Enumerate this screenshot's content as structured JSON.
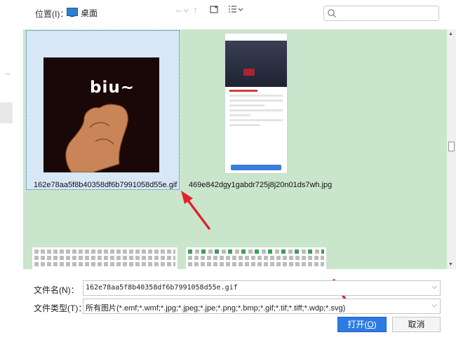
{
  "toolbar": {
    "location_label": "位置(I)：",
    "location_value": "桌面",
    "location_icon": "desktop-icon",
    "back_icon": "←",
    "up_icon": "↑",
    "new_folder_icon": "new-folder-icon",
    "view_icon": "view-list-icon",
    "search_placeholder": ""
  },
  "files": [
    {
      "name": "162e78aa5f8b40358df6b7991058d55e.gif",
      "selected": true,
      "thumb_text": "biu~"
    },
    {
      "name": "469e842dgy1gabdr725j8j20n01ds7wh.jpg",
      "selected": false
    }
  ],
  "form": {
    "filename_label": "文件名(N)：",
    "filename_value": "162e78aa5f8b40358df6b7991058d55e.gif",
    "filetype_label": "文件类型(T)：",
    "filetype_value": "所有图片(*.emf;*.wmf;*.jpg;*.jpeg;*.jpe;*.png;*.bmp;*.gif;*.tif;*.tiff;*.wdp;*.svg)"
  },
  "buttons": {
    "open_label": "打开(",
    "open_key": "O",
    "open_close": ")",
    "cancel_label": "取消"
  },
  "colors": {
    "file_area_bg": "#c9e6cc",
    "selection": "#d7e7f5",
    "primary": "#2d7ae2",
    "annotation_arrow": "#e0242c"
  }
}
